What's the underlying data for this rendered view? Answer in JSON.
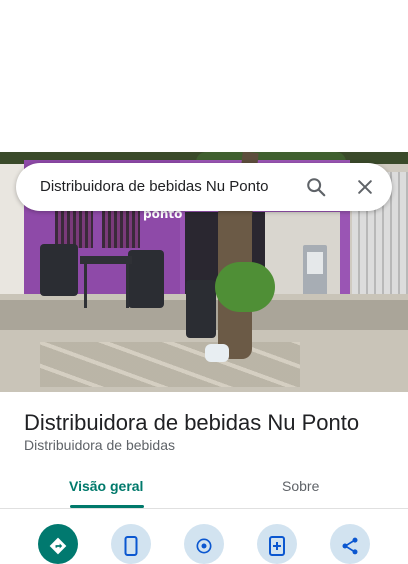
{
  "search": {
    "query": "Distribuidora de bebidas Nu Ponto"
  },
  "photo": {
    "wall_sign": "ponto"
  },
  "place": {
    "title": "Distribuidora de bebidas Nu Ponto",
    "category": "Distribuidora de bebidas"
  },
  "tabs": [
    {
      "label": "Visão geral",
      "active": true
    },
    {
      "label": "Sobre",
      "active": false
    }
  ],
  "actions": [
    {
      "icon": "directions-icon"
    },
    {
      "icon": "phone-icon"
    },
    {
      "icon": "location-icon"
    },
    {
      "icon": "save-icon"
    },
    {
      "icon": "share-icon"
    }
  ],
  "colors": {
    "accent": "#00796b",
    "action_bg": "#d2e3f0",
    "primary_action": "#01796f"
  }
}
